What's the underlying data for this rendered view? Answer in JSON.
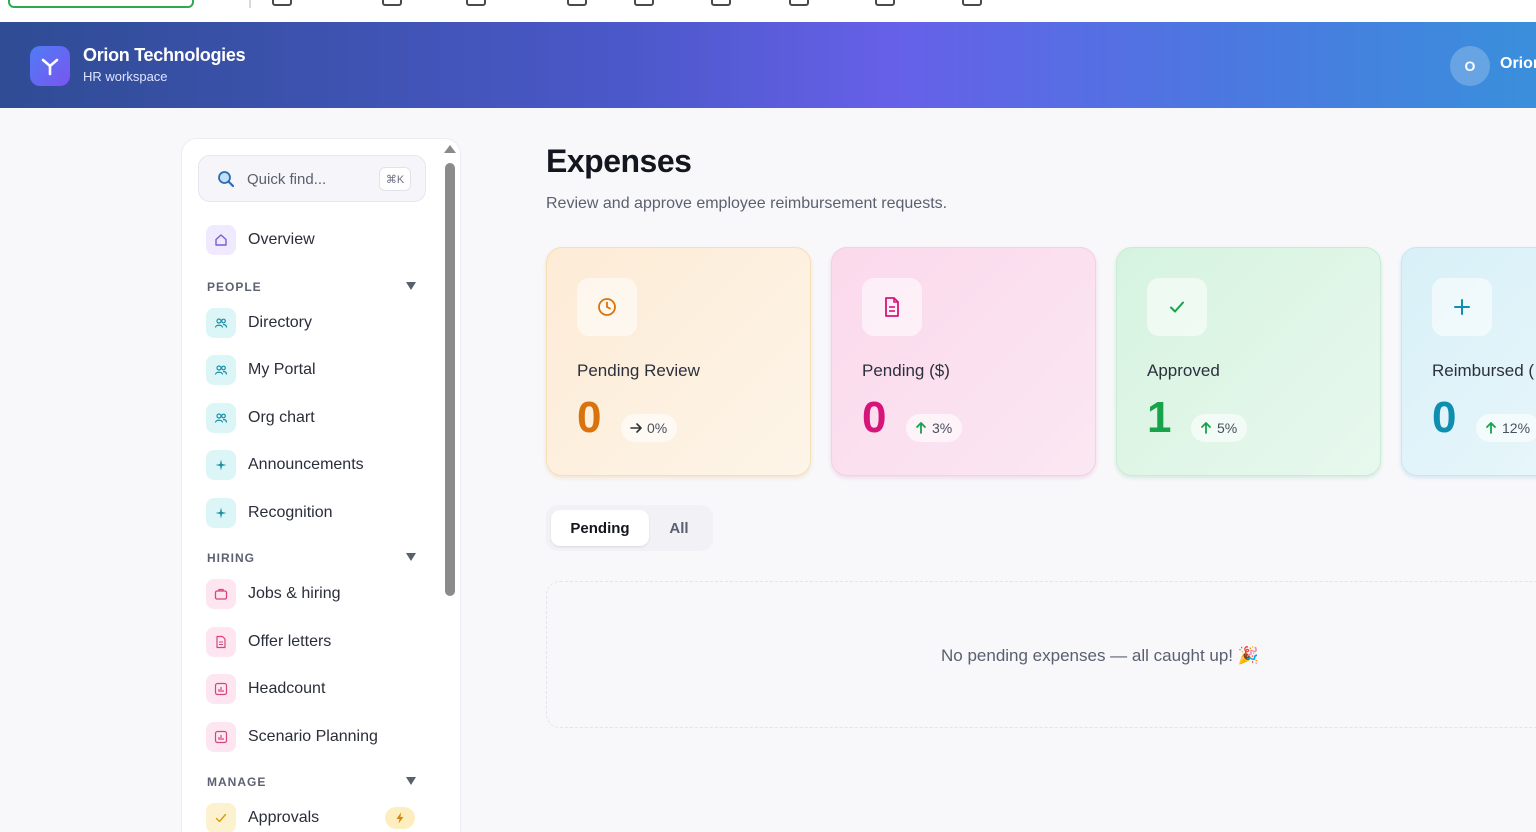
{
  "header": {
    "brand_name": "Orion Technologies",
    "brand_sub": "HR workspace",
    "user_initial": "O",
    "user_name": "Orion"
  },
  "sidebar": {
    "search_placeholder": "Quick find...",
    "search_shortcut": "⌘K",
    "overview": "Overview",
    "sections": {
      "people": "PEOPLE",
      "hiring": "HIRING",
      "manage": "MANAGE"
    },
    "items": {
      "directory": "Directory",
      "my_portal": "My Portal",
      "org_chart": "Org chart",
      "announcements": "Announcements",
      "recognition": "Recognition",
      "jobs": "Jobs & hiring",
      "offer_letters": "Offer letters",
      "headcount": "Headcount",
      "scenario_planning": "Scenario Planning",
      "approvals": "Approvals"
    }
  },
  "main": {
    "title": "Expenses",
    "subtitle": "Review and approve employee reimbursement requests.",
    "cards": [
      {
        "label": "Pending Review",
        "value": "0",
        "delta": "0%",
        "trend": "flat",
        "color": "#d9730d"
      },
      {
        "label": "Pending ($)",
        "value": "0",
        "delta": "3%",
        "trend": "up",
        "color": "#d6157a"
      },
      {
        "label": "Approved",
        "value": "1",
        "delta": "5%",
        "trend": "up",
        "color": "#16a34a"
      },
      {
        "label": "Reimbursed (",
        "value": "0",
        "delta": "12%",
        "trend": "up",
        "color": "#0e8fb0"
      }
    ],
    "tabs": {
      "pending": "Pending",
      "all": "All"
    },
    "empty_message": "No pending expenses — all caught up! 🎉"
  },
  "colors": {
    "banner_start": "#2f4c94",
    "banner_mid": "#6660e8",
    "banner_end": "#3a8fdc",
    "up_arrow": "#16a34a"
  }
}
